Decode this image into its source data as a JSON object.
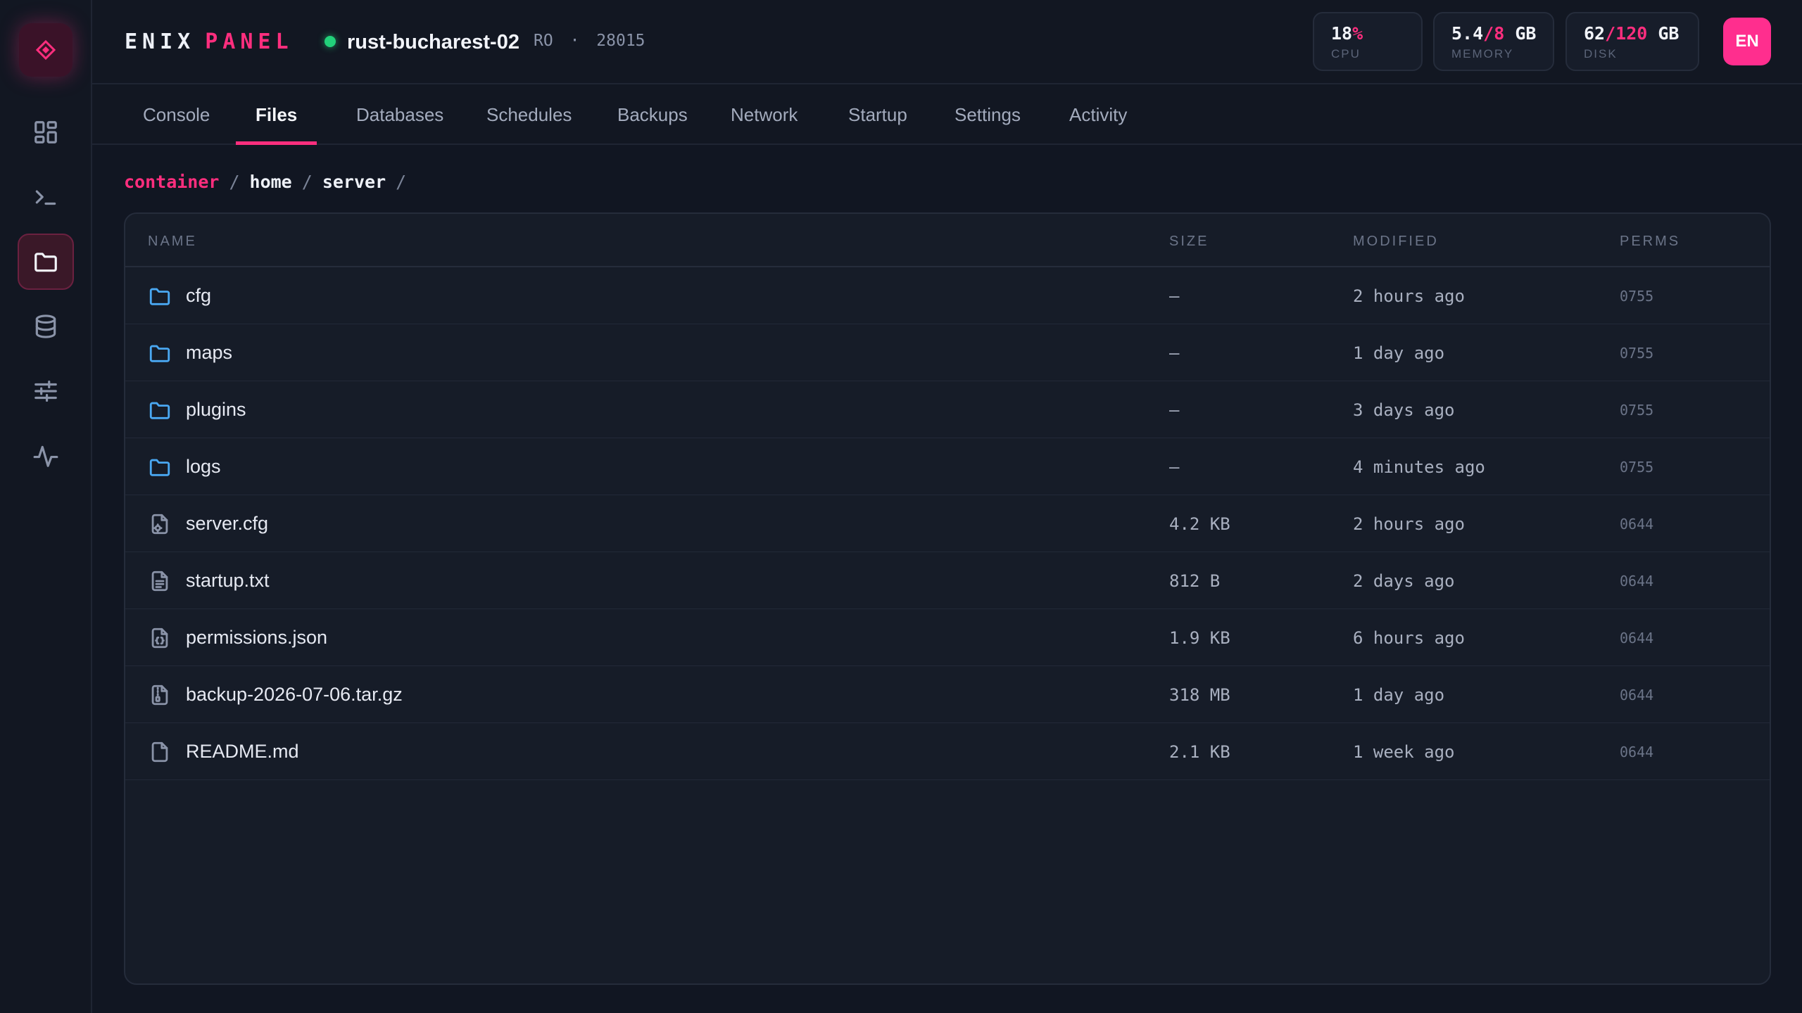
{
  "brand": {
    "part1": "ENIX",
    "part2": "PANEL"
  },
  "server": {
    "name": "rust-bucharest-02",
    "region": "RO",
    "separator": "·",
    "port": "28015",
    "status_color": "#22d17a"
  },
  "stats": [
    {
      "value": "18",
      "accent": "%",
      "unit": "",
      "label": "CPU"
    },
    {
      "value": "5.4",
      "accent": "/8",
      "unit": " GB",
      "label": "MEMORY"
    },
    {
      "value": "62",
      "accent": "/120",
      "unit": " GB",
      "label": "DISK"
    }
  ],
  "lang": "EN",
  "sidebar": {
    "items": [
      {
        "icon": "dashboard-grid-icon",
        "active": false
      },
      {
        "icon": "terminal-icon",
        "active": false
      },
      {
        "icon": "folder-icon",
        "active": true
      },
      {
        "icon": "database-icon",
        "active": false
      },
      {
        "icon": "sliders-icon",
        "active": false
      },
      {
        "icon": "activity-pulse-icon",
        "active": false
      }
    ]
  },
  "tabs": [
    {
      "label": "Console",
      "active": false
    },
    {
      "label": "Files",
      "active": true
    },
    {
      "label": "Databases",
      "active": false
    },
    {
      "label": "Schedules",
      "active": false
    },
    {
      "label": "Backups",
      "active": false
    },
    {
      "label": "Network",
      "active": false
    },
    {
      "label": "Startup",
      "active": false
    },
    {
      "label": "Settings",
      "active": false
    },
    {
      "label": "Activity",
      "active": false
    }
  ],
  "breadcrumb": {
    "root": "container",
    "items": [
      "home",
      "server"
    ],
    "separator": "/"
  },
  "table": {
    "headers": {
      "name": "NAME",
      "size": "SIZE",
      "modified": "MODIFIED",
      "perms": "PERMS"
    },
    "rows": [
      {
        "type": "folder",
        "icon": "folder-icon",
        "name": "cfg",
        "size": "—",
        "modified": "2 hours ago",
        "perms": "0755"
      },
      {
        "type": "folder",
        "icon": "folder-icon",
        "name": "maps",
        "size": "—",
        "modified": "1 day ago",
        "perms": "0755"
      },
      {
        "type": "folder",
        "icon": "folder-icon",
        "name": "plugins",
        "size": "—",
        "modified": "3 days ago",
        "perms": "0755"
      },
      {
        "type": "folder",
        "icon": "folder-icon",
        "name": "logs",
        "size": "—",
        "modified": "4 minutes ago",
        "perms": "0755"
      },
      {
        "type": "file",
        "icon": "config-file-icon",
        "name": "server.cfg",
        "size": "4.2 KB",
        "modified": "2 hours ago",
        "perms": "0644"
      },
      {
        "type": "file",
        "icon": "text-file-icon",
        "name": "startup.txt",
        "size": "812 B",
        "modified": "2 days ago",
        "perms": "0644"
      },
      {
        "type": "file",
        "icon": "json-file-icon",
        "name": "permissions.json",
        "size": "1.9 KB",
        "modified": "6 hours ago",
        "perms": "0644"
      },
      {
        "type": "file",
        "icon": "archive-file-icon",
        "name": "backup-2026-07-06.tar.gz",
        "size": "318 MB",
        "modified": "1 day ago",
        "perms": "0644"
      },
      {
        "type": "file",
        "icon": "file-icon",
        "name": "README.md",
        "size": "2.1 KB",
        "modified": "1 week ago",
        "perms": "0644"
      }
    ]
  },
  "colors": {
    "accent": "#ff2e7e",
    "folder": "#4aa8f2",
    "background": "#111622"
  }
}
